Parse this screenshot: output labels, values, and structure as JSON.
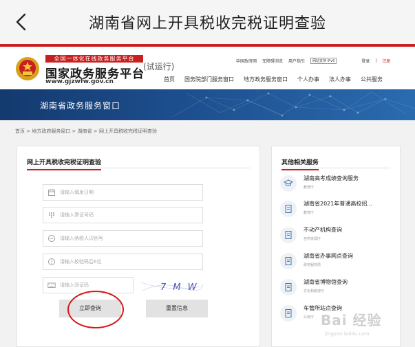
{
  "topbar": {
    "title": "湖南省网上开具税收完税证明查验"
  },
  "header": {
    "slogan": "全国一体化在线政务服务平台",
    "brand": "国家政务服务平台",
    "url": "www.gjzwfw.gov.cn",
    "trial": "(试运行)",
    "util_links": [
      "中国政府网",
      "无障碍浏览",
      "用户指引",
      "网站支持",
      "IPv6"
    ],
    "login": "登录",
    "register": "注册",
    "nav": [
      "首页",
      "国务院部门服务窗口",
      "地方政务服务窗口",
      "个人办事",
      "法人办事",
      "公共服务"
    ]
  },
  "banner": {
    "title": "湖南省政务服务窗口"
  },
  "breadcrumb": "首页 > 地方政府服务窗口 > 湖南省 > 网上开具税收完税证明查验",
  "form": {
    "title": "网上开具税收完税证明查验",
    "fields": [
      {
        "placeholder": "请输入填发日期",
        "icon": "calendar-icon"
      },
      {
        "placeholder": "请输入票证号码",
        "icon": "grid-icon"
      },
      {
        "placeholder": "请输入纳税人识别号",
        "icon": "id-icon"
      },
      {
        "placeholder": "请输入校验码后6位",
        "icon": "shield-icon"
      },
      {
        "placeholder": "请输入验证码",
        "icon": "keyboard-icon"
      }
    ],
    "captcha_text": "7 M W B",
    "query_button": "立即查询",
    "reset_button": "重置信息"
  },
  "side": {
    "title": "其他相关服务",
    "items": [
      {
        "name": "湖南高考成绩查询服务",
        "dept": "教育厅"
      },
      {
        "name": "湖南省2021年普通高校招...",
        "dept": "教育厅"
      },
      {
        "name": "不动产机构查询",
        "dept": "自然资源厅"
      },
      {
        "name": "湖南省办事网点查询",
        "dept": "政务服务局"
      },
      {
        "name": "湖南省博物馆查询",
        "dept": "文化和旅游厅"
      },
      {
        "name": "车管所站点查询",
        "dept": "公安厅"
      }
    ]
  },
  "watermark": {
    "main": "Bai 经验",
    "sub": "jingyan.baidu.com"
  },
  "colors": {
    "accent": "#c9201f",
    "banner": "#1d4f8f",
    "annotation": "#d81616"
  }
}
